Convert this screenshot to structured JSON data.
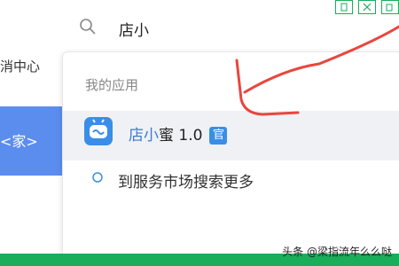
{
  "left_panel": {
    "text_top": "消中心",
    "text_blue": "<家>"
  },
  "search": {
    "query": "店小"
  },
  "dropdown": {
    "section_label": "我的应用",
    "result": {
      "name_highlight": "店小",
      "name_rest": "蜜 1.0",
      "badge": "官"
    },
    "market_text": "到服务市场搜索更多"
  },
  "watermark": "头条 @梁指流年么么哒",
  "icons": [
    "search-icon",
    "app-icon",
    "official-badge",
    "window-control-icons"
  ],
  "colors": {
    "accent": "#3a8ee6",
    "annotation": "#e8463f",
    "green": "#1aad5a"
  }
}
